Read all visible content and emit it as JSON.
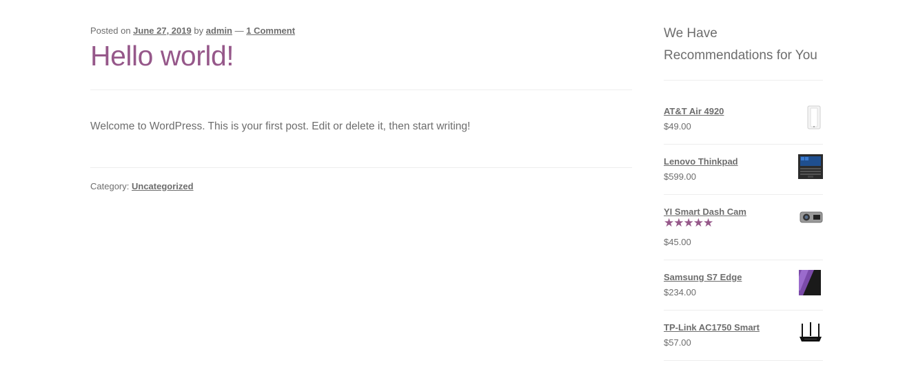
{
  "post": {
    "meta": {
      "posted_on_label": "Posted on",
      "date": "June 27, 2019",
      "by_label": "by",
      "author": "admin",
      "separator": "—",
      "comments": "1 Comment"
    },
    "title": "Hello world!",
    "content": "Welcome to WordPress. This is your first post. Edit or delete it, then start writing!",
    "category_label": "Category:",
    "category": "Uncategorized"
  },
  "sidebar": {
    "widget_title": "We Have Recommendations for You",
    "products": [
      {
        "name": "AT&T Air 4920",
        "price": "$49.00",
        "thumb": "router-tower-icon"
      },
      {
        "name": "Lenovo Thinkpad",
        "price": "$599.00",
        "thumb": "laptop-icon"
      },
      {
        "name": "YI Smart Dash Cam",
        "price": "$45.00",
        "rating": 5,
        "thumb": "dash-cam-icon"
      },
      {
        "name": "Samsung S7 Edge",
        "price": "$234.00",
        "thumb": "phone-icon"
      },
      {
        "name": "TP-Link AC1750 Smart",
        "price": "$57.00",
        "thumb": "wifi-router-icon"
      }
    ]
  },
  "colors": {
    "accent": "#96588a",
    "text": "#6d6d6d",
    "rule": "#ededed"
  }
}
